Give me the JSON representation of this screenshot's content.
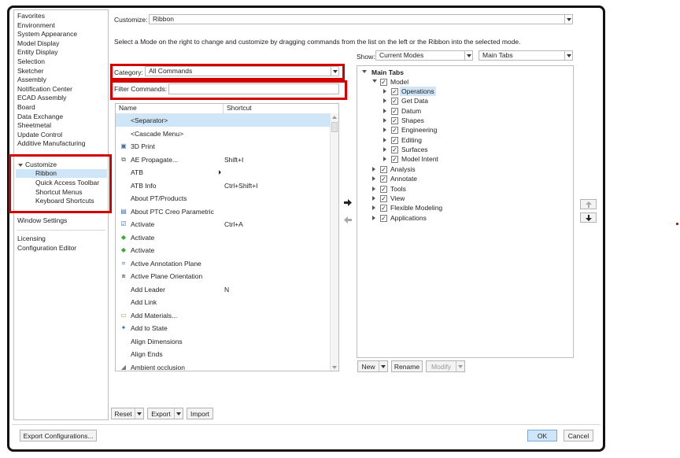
{
  "sidebar": {
    "items": [
      {
        "label": "Favorites"
      },
      {
        "label": "Environment"
      },
      {
        "label": "System Appearance"
      },
      {
        "label": "Model Display"
      },
      {
        "label": "Entity Display"
      },
      {
        "label": "Selection"
      },
      {
        "label": "Sketcher"
      },
      {
        "label": "Assembly"
      },
      {
        "label": "Notification Center"
      },
      {
        "label": "ECAD Assembly"
      },
      {
        "label": "Board"
      },
      {
        "label": "Data Exchange"
      },
      {
        "label": "Sheetmetal"
      },
      {
        "label": "Update Control"
      },
      {
        "label": "Additive Manufacturing"
      }
    ],
    "customize": {
      "label": "Customize",
      "children": [
        {
          "label": "Ribbon"
        },
        {
          "label": "Quick Access Toolbar"
        },
        {
          "label": "Shortcut Menus"
        },
        {
          "label": "Keyboard Shortcuts"
        }
      ]
    },
    "window_settings": "Window Settings",
    "bottom_items": [
      {
        "label": "Licensing"
      },
      {
        "label": "Configuration Editor"
      }
    ]
  },
  "customize": {
    "label": "Customize:",
    "value": "Ribbon"
  },
  "instruction": "Select a Mode on the right to change and customize by dragging commands from the list on the left or the Ribbon into the selected mode.",
  "category": {
    "label": "Category:",
    "value": "All Commands"
  },
  "filter": {
    "label": "Filter Commands:",
    "value": ""
  },
  "show": {
    "label": "Show:",
    "mode": "Current Modes",
    "tabs": "Main Tabs"
  },
  "commands": {
    "headers": {
      "name": "Name",
      "shortcut": "Shortcut"
    },
    "rows": [
      {
        "name": "<Separator>",
        "shortcut": "",
        "icon": "none"
      },
      {
        "name": "<Cascade Menu>",
        "shortcut": "",
        "icon": "none"
      },
      {
        "name": "3D Print",
        "shortcut": "",
        "icon": "printer-icon"
      },
      {
        "name": "AE Propagate...",
        "shortcut": "Shift+I",
        "icon": "propagate-icon"
      },
      {
        "name": "ATB",
        "shortcut": "",
        "icon": "none",
        "submenu": true
      },
      {
        "name": "ATB Info",
        "shortcut": "Ctrl+Shift+I",
        "icon": "none"
      },
      {
        "name": "About PT/Products",
        "shortcut": "",
        "icon": "none"
      },
      {
        "name": "About PTC Creo Parametric",
        "shortcut": "",
        "icon": "info-window-icon"
      },
      {
        "name": "Activate",
        "shortcut": "Ctrl+A",
        "icon": "activate-check-icon"
      },
      {
        "name": "Activate",
        "shortcut": "",
        "icon": "activate-diamond-icon"
      },
      {
        "name": "Activate",
        "shortcut": "",
        "icon": "activate-diamond-icon"
      },
      {
        "name": "Active Annotation Plane",
        "shortcut": "",
        "icon": "annotation-plane-icon"
      },
      {
        "name": "Active Plane Orientation",
        "shortcut": "",
        "icon": "plane-orientation-icon"
      },
      {
        "name": "Add Leader",
        "shortcut": "N",
        "icon": "none"
      },
      {
        "name": "Add Link",
        "shortcut": "",
        "icon": "none"
      },
      {
        "name": "Add Materials...",
        "shortcut": "",
        "icon": "materials-icon"
      },
      {
        "name": "Add to State",
        "shortcut": "",
        "icon": "add-state-icon"
      },
      {
        "name": "Align Dimensions",
        "shortcut": "",
        "icon": "none"
      },
      {
        "name": "Align Ends",
        "shortcut": "",
        "icon": "none"
      },
      {
        "name": "Ambient occlusion",
        "shortcut": "",
        "icon": "occlusion-icon"
      }
    ]
  },
  "tree": {
    "root": "Main Tabs",
    "model": "Model",
    "model_children": [
      "Operations",
      "Get Data",
      "Datum",
      "Shapes",
      "Engineering",
      "Editing",
      "Surfaces",
      "Model Intent"
    ],
    "others": [
      "Analysis",
      "Annotate",
      "Tools",
      "View",
      "Flexible Modeling",
      "Applications"
    ]
  },
  "buttons": {
    "new": "New",
    "rename": "Rename",
    "modify": "Modify",
    "reset": "Reset",
    "export": "Export",
    "import": "Import",
    "export_config": "Export Configurations...",
    "ok": "OK",
    "cancel": "Cancel"
  },
  "colors": {
    "highlight": "#cfe6f8",
    "annotation_red": "#d40000",
    "ok_blue": "#7aa9d2"
  }
}
